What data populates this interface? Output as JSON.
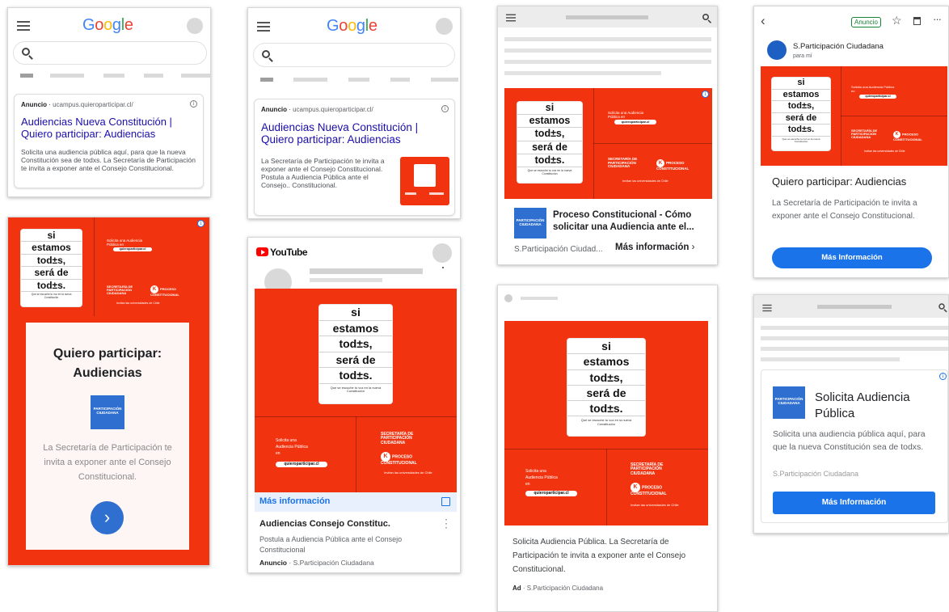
{
  "poster": {
    "stack_lines": [
      "si",
      "estamos",
      "tod±s,",
      "será de",
      "tod±s."
    ],
    "tagline": "Que se escuche tu voz en la nueva Constitución",
    "solicita_text": "Solicita una Audiencia Pública en",
    "url_pill": "quieroparticipar.cl",
    "sp_logo": "SECRETARÍA DE PARTICIPACIÓN CIUDADANA",
    "pc_logo": "PROCESO CONSTITUCIONAL",
    "invitan": "Invitan las universidades de Chile"
  },
  "card1": {
    "logo": [
      "G",
      "o",
      "o",
      "g",
      "l",
      "e"
    ],
    "ad_label": "Anuncio",
    "ad_url": "ucampus.quieroparticipar.cl/",
    "title": "Audiencias Nueva Constitución | Quiero participar: Audiencias",
    "desc": "Solicita una audiencia pública aquí, para que la nueva Constitución sea de todxs. La Secretaría de Participación te invita a exponer ante el Consejo Constitucional."
  },
  "card2": {
    "logo": [
      "G",
      "o",
      "o",
      "g",
      "l",
      "e"
    ],
    "ad_label": "Anuncio",
    "ad_url": "ucampus.quieroparticipar.cl/",
    "title": "Audiencias Nueva Constitución | Quiero participar: Audiencias",
    "desc": "La Secretaría de Participación te invita a exponer ante el Consejo Constitucional. Postula a Audiencia Pública ante el Consejo.. Constitucional."
  },
  "card3": {
    "title": "Proceso Constitucional - Cómo solicitar una Audiencia ante el...",
    "advertiser": "S.Participación Ciudad...",
    "cta": "Más información"
  },
  "card4": {
    "badge": "Anuncio",
    "sender": "S.Participación Ciudadana",
    "to": "para mí",
    "title": "Quiero participar: Audiencias",
    "desc": "La Secretaría de Participación te invita a exponer ante el Consejo Constitucional.",
    "cta": "Más Información"
  },
  "card5": {
    "title": "Quiero participar: Audiencias",
    "desc": "La Secretaría de Participación te invita a exponer ante el Consejo Constitucional."
  },
  "card6": {
    "logo": "YouTube",
    "cta": "Más información",
    "title": "Audiencias Consejo Constituc.",
    "desc": "Postula a Audiencia Pública ante el Consejo Constitucional",
    "ad_label": "Anuncio",
    "advertiser": "S.Participación Ciudadana"
  },
  "card7": {
    "desc": "Solicita Audiencia Pública. La Secretaría de Participación te invita a exponer ante el Consejo Constitucional.",
    "ad_label": "Ad",
    "advertiser": "S.Participación Ciudadana"
  },
  "card8": {
    "title": "Solicita Audiencia Pública",
    "desc": "Solicita una audiencia pública aquí, para que la nueva Constitución sea de todxs.",
    "advertiser": "S.Participación Ciudadana",
    "cta": "Más Información"
  },
  "colors": {
    "brand_red": "#f2330f",
    "google_blue": "#1a73e8",
    "link": "#1a0dab"
  }
}
